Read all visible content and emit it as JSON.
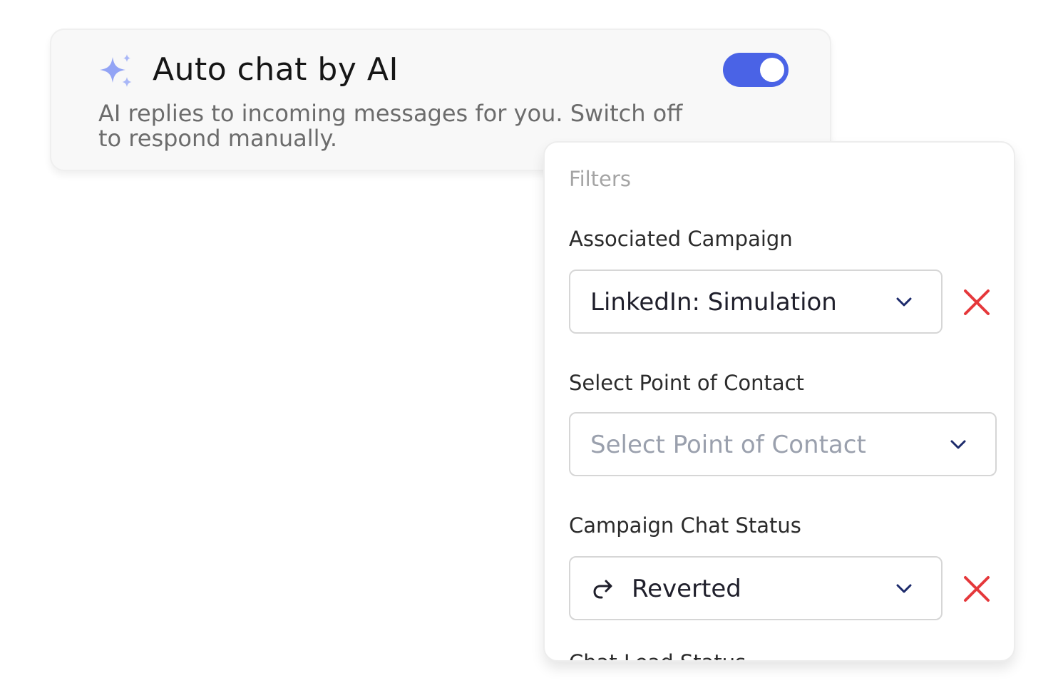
{
  "auto_chat": {
    "icon": "sparkle-icon",
    "title": "Auto chat by AI",
    "description": "AI replies to incoming messages for you. Switch off to respond manually.",
    "enabled": true,
    "accent_color": "#4a63e6"
  },
  "filters": {
    "title": "Filters",
    "associated_campaign": {
      "label": "Associated Campaign",
      "value": "LinkedIn: Simulation"
    },
    "point_of_contact": {
      "label": "Select Point of Contact",
      "placeholder": "Select Point of Contact"
    },
    "campaign_chat_status": {
      "label": "Campaign Chat Status",
      "value": "Reverted",
      "icon": "redo-arrow-icon"
    },
    "next_label_partial": "Chat Lead Status",
    "clear_color": "#e5383b"
  }
}
